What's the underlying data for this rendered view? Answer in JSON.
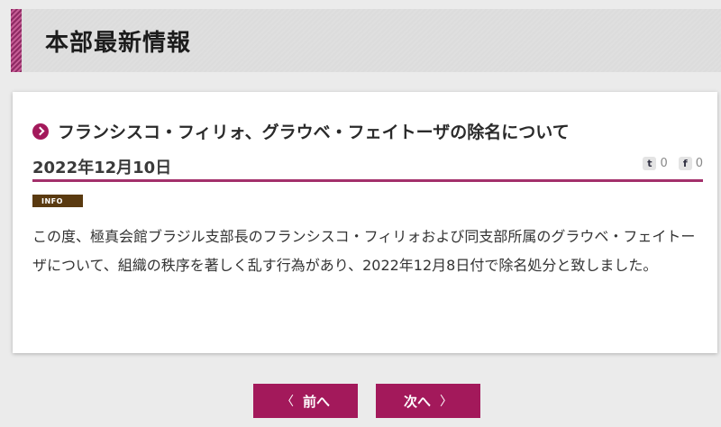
{
  "section": {
    "title": "本部最新情報"
  },
  "article": {
    "title": "フランシスコ・フィリォ、グラウベ・フェイトーザの除名について",
    "date": "2022年12月10日",
    "tag": "INFO",
    "body": "この度、極真会館ブラジル支部長のフランシスコ・フィリォおよび同支部所属のグラウベ・フェイトーザについて、組織の秩序を著しく乱す行為があり、2022年12月8日付で除名処分と致しました。"
  },
  "social": {
    "twitter_icon": "t",
    "twitter_count": "0",
    "facebook_icon": "f",
    "facebook_count": "0"
  },
  "nav": {
    "prev_label": "前へ",
    "prev_chevron": "〈",
    "next_label": "次へ",
    "next_chevron": "〉"
  },
  "colors": {
    "accent": "#a3195b",
    "tag_bg": "#5a3a10"
  }
}
